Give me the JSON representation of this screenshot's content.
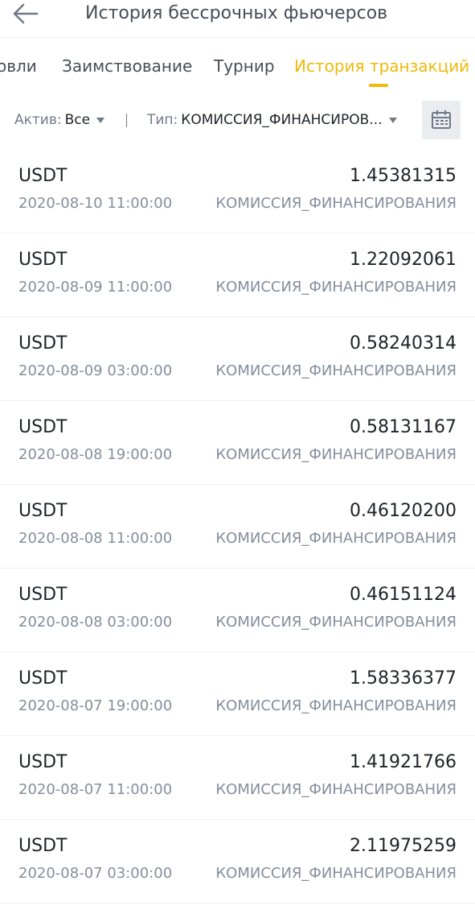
{
  "header": {
    "title": "История бессрочных фьючерсов",
    "back_icon": "arrow-left-icon"
  },
  "tabs": [
    {
      "label": "овли",
      "active": false
    },
    {
      "label": "Заимствование",
      "active": false
    },
    {
      "label": "Турнир",
      "active": false
    },
    {
      "label": "История транзакций",
      "active": true
    }
  ],
  "filters": {
    "asset_label": "Актив:",
    "asset_value": "Все",
    "type_label": "Тип:",
    "type_value": "КОМИССИЯ_ФИНАНСИРОВ...",
    "calendar_icon": "calendar-icon"
  },
  "colors": {
    "accent": "#f0b90b",
    "text_primary": "#1e2329",
    "text_secondary": "#848e9c"
  },
  "transactions": [
    {
      "asset": "USDT",
      "amount": "1.45381315",
      "datetime": "2020-08-10 11:00:00",
      "type": "КОМИССИЯ_ФИНАНСИРОВАНИЯ"
    },
    {
      "asset": "USDT",
      "amount": "1.22092061",
      "datetime": "2020-08-09 11:00:00",
      "type": "КОМИССИЯ_ФИНАНСИРОВАНИЯ"
    },
    {
      "asset": "USDT",
      "amount": "0.58240314",
      "datetime": "2020-08-09 03:00:00",
      "type": "КОМИССИЯ_ФИНАНСИРОВАНИЯ"
    },
    {
      "asset": "USDT",
      "amount": "0.58131167",
      "datetime": "2020-08-08 19:00:00",
      "type": "КОМИССИЯ_ФИНАНСИРОВАНИЯ"
    },
    {
      "asset": "USDT",
      "amount": "0.46120200",
      "datetime": "2020-08-08 11:00:00",
      "type": "КОМИССИЯ_ФИНАНСИРОВАНИЯ"
    },
    {
      "asset": "USDT",
      "amount": "0.46151124",
      "datetime": "2020-08-08 03:00:00",
      "type": "КОМИССИЯ_ФИНАНСИРОВАНИЯ"
    },
    {
      "asset": "USDT",
      "amount": "1.58336377",
      "datetime": "2020-08-07 19:00:00",
      "type": "КОМИССИЯ_ФИНАНСИРОВАНИЯ"
    },
    {
      "asset": "USDT",
      "amount": "1.41921766",
      "datetime": "2020-08-07 11:00:00",
      "type": "КОМИССИЯ_ФИНАНСИРОВАНИЯ"
    },
    {
      "asset": "USDT",
      "amount": "2.11975259",
      "datetime": "2020-08-07 03:00:00",
      "type": "КОМИССИЯ_ФИНАНСИРОВАНИЯ"
    }
  ]
}
